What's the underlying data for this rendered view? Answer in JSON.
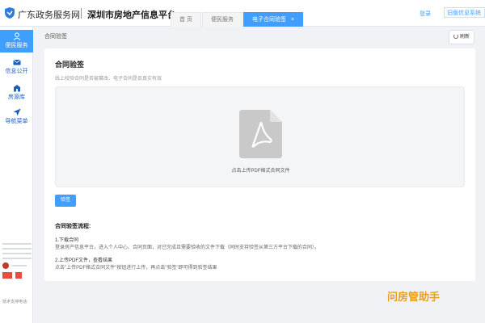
{
  "header": {
    "brand": "广东政务服务网",
    "site_title": "深圳市房地产信息平台",
    "tabs": [
      {
        "label": "首 页"
      },
      {
        "label": "便民服务"
      },
      {
        "label": "电子合同验签",
        "close": "×"
      }
    ],
    "login": "登录",
    "old_system": "旧版信息系统"
  },
  "sidebar": {
    "items": [
      {
        "label": "便民服务",
        "icon": "service-icon",
        "active": true
      },
      {
        "label": "信息公开",
        "icon": "mail-icon"
      },
      {
        "label": "房源库",
        "icon": "building-icon"
      },
      {
        "label": "导航菜单",
        "icon": "navigation-icon"
      }
    ],
    "tech_support": "技术支持电话:"
  },
  "main": {
    "breadcrumb": "合同验签",
    "refresh": "刷新",
    "card": {
      "title": "合同验签",
      "desc": "线上校验合同是否被篡改、电子合同是否真实有效",
      "upload_text": "点击上传PDF格式合同文件",
      "verify_button": "验签",
      "steps_title": "合同验签流程:",
      "step1_title": "1.下载合同",
      "step1_desc": "登录房产信息平台，进入个人中心、合同页面，对已完成且需要验收的文件下载（同时支持验签从第三方平台下载的合同）。",
      "step2_title": "2.上传PDF文件，查看结果",
      "step2_desc": "点击\"上传PDF格式合同文件\"按钮进行上传，再点击\"验签\"即可得到验签结果"
    }
  },
  "watermark": "问房管助手",
  "colors": {
    "accent": "#409eff",
    "nav_text": "#1d5fb8",
    "watermark": "#e8a020"
  }
}
